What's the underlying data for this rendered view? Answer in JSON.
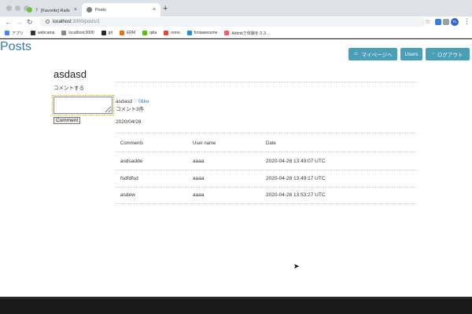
{
  "browser": {
    "tabs": [
      {
        "title": "？ [Favorite] Rails いいね機能",
        "active": false
      },
      {
        "title": "Posts",
        "active": true
      }
    ],
    "new_tab_glyph": "+",
    "close_glyph": "×",
    "url_host": "localhost",
    "url_path": ":3000/posts/1",
    "profile_initials": "YL",
    "bookmarks": [
      {
        "label": "アプリ",
        "icon_color": "#4285f4"
      },
      {
        "label": "webcamp",
        "icon_color": "#333333"
      },
      {
        "label": "localhost:3000",
        "icon_color": "#888888"
      },
      {
        "label": "git",
        "icon_color": "#24292e"
      },
      {
        "label": "ERM",
        "icon_color": "#e8710a"
      },
      {
        "label": "qiita",
        "icon_color": "#55c500"
      },
      {
        "label": "remo",
        "icon_color": "#ea4335"
      },
      {
        "label": "fontawesome",
        "icon_color": "#228ae6"
      },
      {
        "label": "Airbnbで体験をスス…",
        "icon_color": "#ff5a5f"
      }
    ]
  },
  "header": {
    "brand": "Posts",
    "mypage_label": "マイページへ",
    "users_label": "Users",
    "logout_label": "ログアウト",
    "button_color": "#4a9fb8"
  },
  "post": {
    "title": "asdasd",
    "comment_prompt": "コメントする",
    "submit_label": "Comment",
    "name": "asdasd",
    "likes": "0like",
    "comment_count": "コメント3件",
    "date": "2020/04/28"
  },
  "comments_table": {
    "headers": [
      "Comments",
      "User name",
      "Date"
    ],
    "rows": [
      [
        "asdsadde",
        "aaaa",
        "2020-04-28 13:49:07 UTC"
      ],
      [
        "fsdfdfsd",
        "aaaa",
        "2020-04-28 13:49:17 UTC"
      ],
      [
        "asdew",
        "aaaa",
        "2020-04-28 13:53:27 UTC"
      ]
    ]
  }
}
